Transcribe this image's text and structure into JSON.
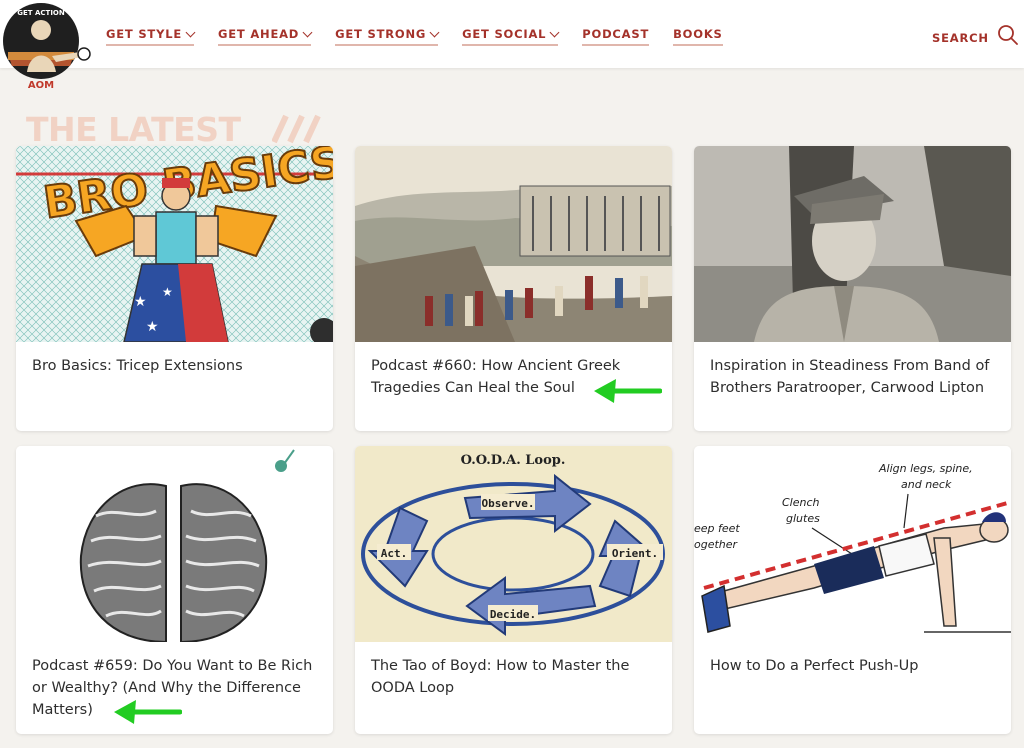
{
  "header": {
    "logo_text_top": "GET ACTION",
    "logo_text_bottom": "AOM",
    "nav": [
      {
        "label": "GET STYLE",
        "dropdown": true
      },
      {
        "label": "GET AHEAD",
        "dropdown": true
      },
      {
        "label": "GET STRONG",
        "dropdown": true
      },
      {
        "label": "GET SOCIAL",
        "dropdown": true
      },
      {
        "label": "PODCAST",
        "dropdown": false
      },
      {
        "label": "BOOKS",
        "dropdown": false
      }
    ],
    "search_label": "SEARCH",
    "search_icon": "search-icon"
  },
  "section": {
    "title": "THE LATEST"
  },
  "cards": [
    {
      "title": "Bro Basics: Tricep Extensions",
      "image_text": "BRO BASICS"
    },
    {
      "title": "Podcast #660: How Ancient Greek Tragedies Can Heal the Soul"
    },
    {
      "title": "Inspiration in Steadiness From Band of Brothers Paratrooper, Carwood Lipton"
    },
    {
      "title": "Podcast #659: Do You Want to Be Rich or Wealthy? (And Why the Difference Matters)"
    },
    {
      "title": "The Tao of Boyd: How to Master the OODA Loop",
      "image_text": {
        "heading": "O.O.D.A. Loop.",
        "observe": "Observe.",
        "orient": "Orient.",
        "decide": "Decide.",
        "act": "Act."
      }
    },
    {
      "title": "How to Do a Perfect Push-Up",
      "image_text": {
        "align": "Align legs, spine,",
        "align2": "and neck",
        "clench": "Clench",
        "glutes": "glutes",
        "keep": "eep feet",
        "together": "ogether"
      }
    }
  ],
  "colors": {
    "brand_red": "#a4322a",
    "title_peach": "#f1d2c4",
    "annotation_arrow": "#22cc22",
    "background": "#f4f2ee"
  }
}
